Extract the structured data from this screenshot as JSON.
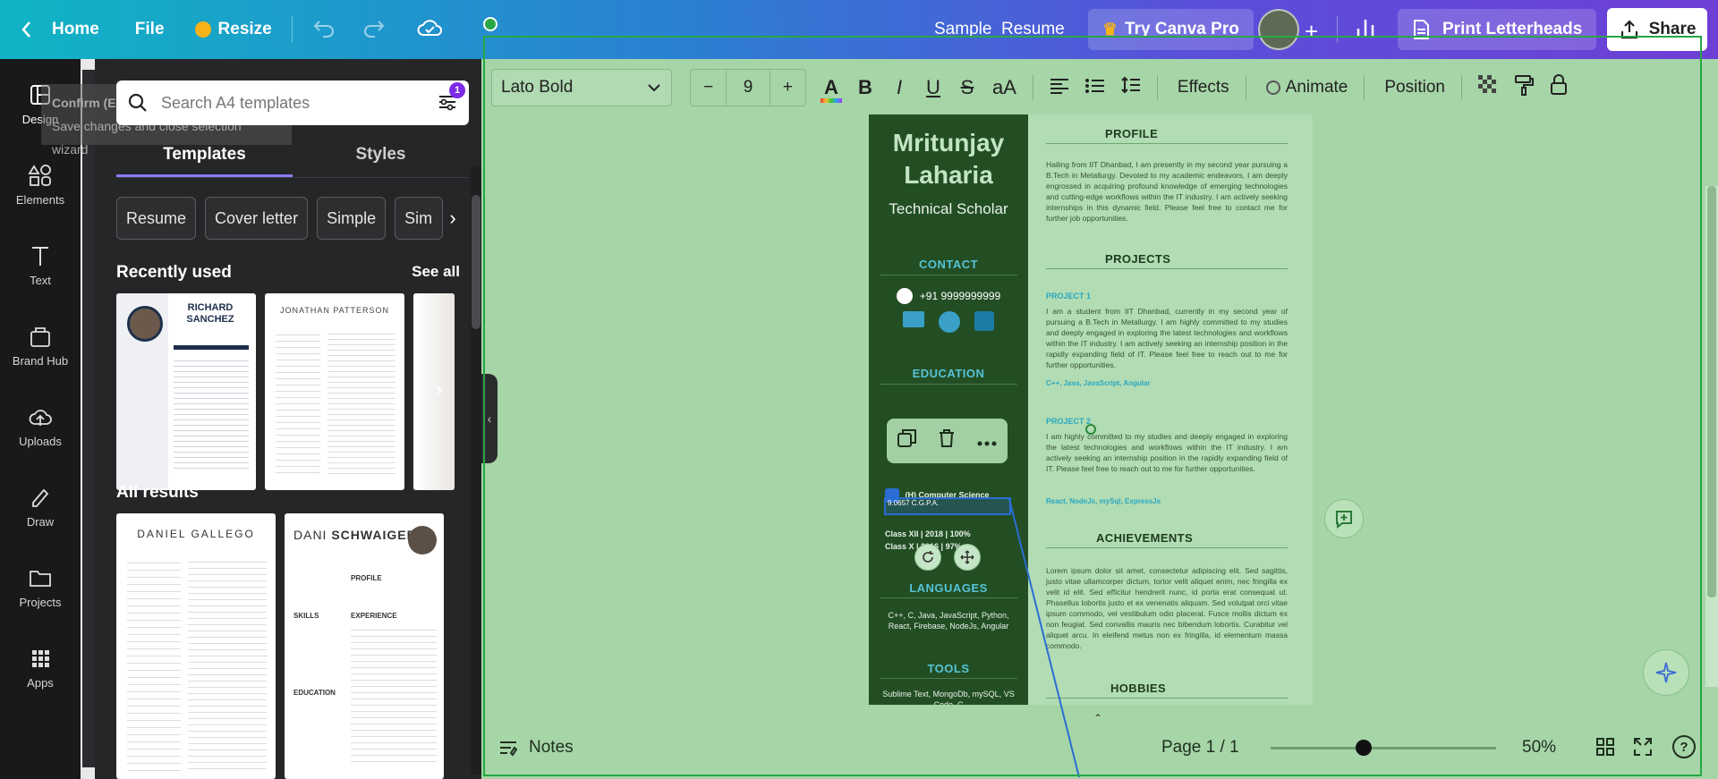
{
  "topbar": {
    "home": "Home",
    "file": "File",
    "resize": "Resize",
    "doc_title": "Sample_Resume",
    "try_pro": "Try Canva Pro",
    "print": "Print Letterheads",
    "share": "Share"
  },
  "rail": {
    "items": [
      "Design",
      "Elements",
      "Text",
      "Brand Hub",
      "Uploads",
      "Draw",
      "Projects",
      "Apps"
    ]
  },
  "panel": {
    "search_placeholder": "Search A4 templates",
    "filter_badge": "1",
    "tabs": [
      "Templates",
      "Styles"
    ],
    "chips": [
      "Resume",
      "Cover letter",
      "Simple",
      "Sim"
    ],
    "recently_used": "Recently used",
    "see_all": "See all",
    "all_results": "All results",
    "thumbs": {
      "t1_name": "RICHARD SANCHEZ",
      "t2_name": "JONATHAN PATTERSON",
      "t3_name": "DANIEL GALLEGO",
      "t4_name_a": "DANI",
      "t4_name_b": "SCHWAIGER",
      "t4_profile": "PROFILE",
      "t4_experience": "EXPERIENCE",
      "t4_skills": "SKILLS",
      "t4_education": "EDUCATION"
    },
    "ghost_text": "Save changes and close selection wizard",
    "ghost_confirm": "Confirm (E"
  },
  "toolbar": {
    "font": "Lato Bold",
    "minus": "−",
    "size": "9",
    "plus": "+",
    "effects": "Effects",
    "animate": "Animate",
    "position": "Position"
  },
  "resume": {
    "name_first": "Mritunjay",
    "name_last": "Laharia",
    "role": "Technical Scholar",
    "contact": "CONTACT",
    "phone": "+91 9999999999",
    "education": "EDUCATION",
    "degree": "(H) Computer Science",
    "cgpa": "9.0657 C.G.P.A.",
    "class12": "Class XII  |  2018  |  100%",
    "class10": "Class X  |  2016  |  97%",
    "languages": "LANGUAGES",
    "languages_text": "C++, C, Java, JavaScript, Python, React, Firebase, NodeJs, Angular",
    "tools": "TOOLS",
    "tools_text": "Sublime Text, MongoDb, mySQL, VS Code, C",
    "profile": "PROFILE",
    "profile_text": "Hailing from IIT Dhanbad, I am presently in my second year pursuing a B.Tech in Metallurgy. Devoted to my academic endeavors, I am deeply engrossed in acquiring profound knowledge of emerging technologies and cutting-edge workflows within the IT industry. I am actively seeking internships in this dynamic field. Please feel free to contact me for further job opportunities.",
    "projects": "PROJECTS",
    "project1": "PROJECT 1",
    "project1_text": "I am a student from IIT Dhanbad, currently in my second year of pursuing a B.Tech in Metallurgy. I am highly committed to my studies and deeply engaged in exploring the latest technologies and workflows within the IT industry. I am actively seeking an internship position in the rapidly expanding field of IT. Please feel free to reach out to me for further opportunities.",
    "project1_tech": "C++, Java, JavaScript, Angular",
    "project2": "PROJECT 2",
    "project2_text": "I am highly committed to my studies and deeply engaged in exploring the latest technologies and workflows within the IT industry. I am actively seeking an internship position in the rapidly expanding field of IT. Please feel free to reach out to me for further opportunities.",
    "project2_tech": "React, NodeJs, mySql, ExpressJs",
    "achievements": "ACHIEVEMENTS",
    "achievements_text": "Lorem ipsum dolor sit amet, consectetur adipiscing elit. Sed sagittis, justo vitae ullamcorper dictum, tortor velit aliquet enim, nec fringilla ex velit id elit. Sed efficitur hendrerit nunc, id porta erat consequat ut. Phasellus lobortis justo et ex venenatis aliquam. Sed volutpat orci vitae ipsum commodo, vel vestibulum odio placerat. Fusce mollis dictum ex non feugiat. Sed convallis mauris nec bibendum lobortis. Curabitur vel aliquet arcu. In eleifend metus non ex fringilla, id elementum massa commodo.",
    "hobbies": "HOBBIES"
  },
  "footer": {
    "notes": "Notes",
    "page": "Page 1 / 1",
    "zoom": "50%",
    "zoom_level": 0.5
  },
  "colors": {
    "side": "#234e24",
    "accent": "#2aa8c2",
    "overlay": "#a6d5a7"
  }
}
